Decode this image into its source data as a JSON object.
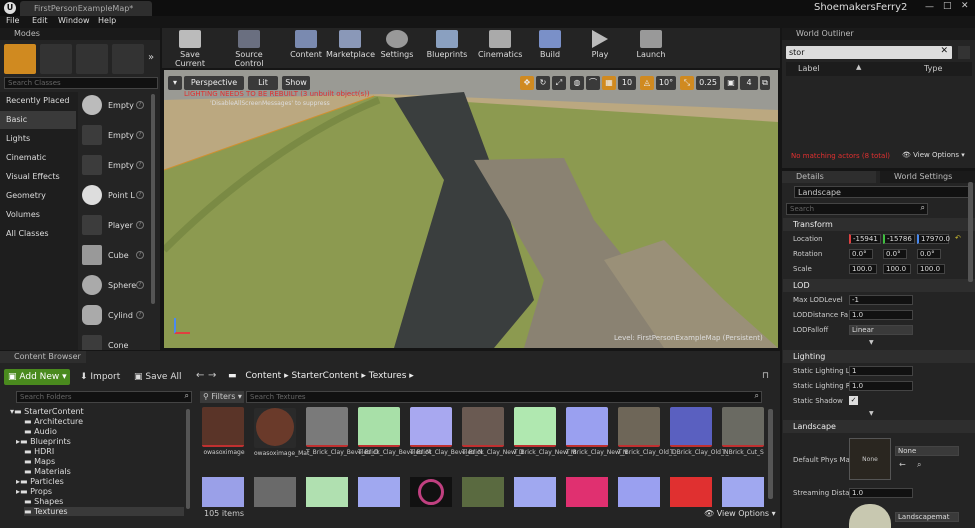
{
  "app": {
    "window_tab": "FirstPersonExampleMap*",
    "project": "ShoemakersFerry2"
  },
  "menu": [
    "File",
    "Edit",
    "Window",
    "Help"
  ],
  "modes": {
    "tab": "Modes",
    "search_placeholder": "Search Classes",
    "categories": [
      "Recently Placed",
      "Basic",
      "Lights",
      "Cinematic",
      "Visual Effects",
      "Geometry",
      "Volumes",
      "All Classes"
    ],
    "items": [
      "Empty",
      "Empty",
      "Empty",
      "Point L",
      "Player",
      "Cube",
      "Sphere",
      "Cylind",
      "Cone"
    ]
  },
  "toolbar": [
    "Save Current",
    "Source Control",
    "Content",
    "Marketplace",
    "Settings",
    "Blueprints",
    "Cinematics",
    "Build",
    "Play",
    "Launch"
  ],
  "viewport": {
    "perspective": "Perspective",
    "lit": "Lit",
    "show": "Show",
    "warning": "LIGHTING NEEDS TO BE REBUILT (3 unbuilt object(s))",
    "suppress": "'DisableAllScreenMessages' to suppress",
    "level": "Level:  FirstPersonExampleMap (Persistent)",
    "grid": "10",
    "rot": "10°",
    "scale": "0.25",
    "cams": "4"
  },
  "outliner": {
    "tab": "World Outliner",
    "search": "stor",
    "col_label": "Label",
    "col_type": "Type",
    "empty": "No matching actors (8 total)",
    "view_options": "View Options"
  },
  "details": {
    "tab": "Details",
    "tab2": "World Settings",
    "object": "Landscape",
    "search_placeholder": "Search",
    "transform": "Transform",
    "location": "Location",
    "rotation": "Rotation",
    "scale": "Scale",
    "loc": [
      "-15941",
      "-15786",
      "17970.0"
    ],
    "rot": [
      "0.0°",
      "0.0°",
      "0.0°"
    ],
    "scl": [
      "100.0",
      "100.0",
      "100.0"
    ],
    "lod": "LOD",
    "max_lod": "Max LODLevel",
    "max_lod_v": "-1",
    "lod_dist": "LODDistance Fa",
    "lod_dist_v": "1.0",
    "lod_falloff": "LODFalloff",
    "lod_falloff_v": "Linear",
    "lighting": "Lighting",
    "static_l1": "Static Lighting L",
    "static_l1_v": "1",
    "static_l2": "Static Lighting R",
    "static_l2_v": "1.0",
    "static_shadow": "Static Shadow",
    "landscape": "Landscape",
    "phys": "Default Phys Ma",
    "phys_thumb": "None",
    "phys_v": "None",
    "stream": "Streaming Dista",
    "stream_v": "1.0",
    "mat": "Landscapemat"
  },
  "content_browser": {
    "tab": "Content Browser",
    "add_new": "Add New",
    "import": "Import",
    "save_all": "Save All",
    "path": [
      "Content",
      "StarterContent",
      "Textures"
    ],
    "search_folders": "Search Folders",
    "filters": "Filters",
    "search_textures": "Search Textures",
    "folders": [
      "StarterContent",
      "Architecture",
      "Audio",
      "Blueprints",
      "HDRI",
      "Maps",
      "Materials",
      "Particles",
      "Props",
      "Shapes",
      "Textures"
    ],
    "assets": [
      "owasoximage",
      "owasoximage_Mat",
      "T_Brick_Clay_Beveled_D",
      "T_Brick_Clay_Beveled_M",
      "T_Brick_Clay_Beveled_N",
      "T_Brick_Clay_New_D",
      "T_Brick_Clay_New_M",
      "T_Brick_Clay_New_N",
      "T_Brick_Clay_Old_D",
      "T_Brick_Clay_Old_N",
      "T_Brick_Cut_Stone_D"
    ],
    "count": "105 items",
    "view_options": "View Options"
  },
  "colors": {
    "accent": "#d08a20",
    "add_new": "#4a8a1e",
    "warning": "#e03030"
  }
}
